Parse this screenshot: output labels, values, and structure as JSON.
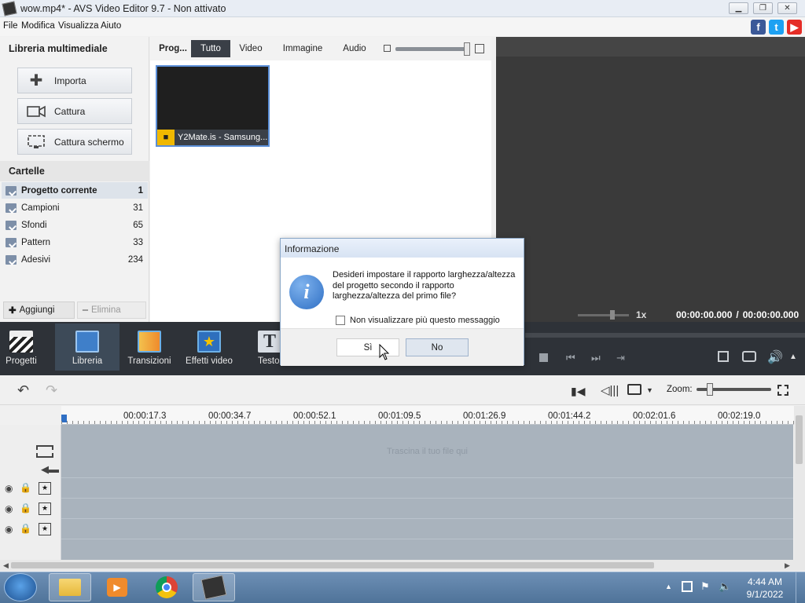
{
  "window": {
    "title": "wow.mp4* - AVS Video Editor 9.7 - Non attivato"
  },
  "menu": [
    "File",
    "Modifica",
    "Visualizza",
    "Aiuto"
  ],
  "social": [
    {
      "name": "facebook",
      "glyph": "f",
      "color": "#3b5998"
    },
    {
      "name": "twitter",
      "glyph": "t",
      "color": "#1da1f2"
    },
    {
      "name": "youtube",
      "glyph": "▶",
      "color": "#e52d27"
    }
  ],
  "library": {
    "title": "Libreria multimediale",
    "buttons": [
      {
        "label": "Importa",
        "icon": "plus-icon"
      },
      {
        "label": "Cattura",
        "icon": "camera-icon"
      },
      {
        "label": "Cattura schermo",
        "icon": "screen-capture-icon"
      }
    ]
  },
  "folders": {
    "title": "Cartelle",
    "items": [
      {
        "label": "Progetto corrente",
        "count": "1",
        "selected": true
      },
      {
        "label": "Campioni",
        "count": "31"
      },
      {
        "label": "Sfondi",
        "count": "65"
      },
      {
        "label": "Pattern",
        "count": "33"
      },
      {
        "label": "Adesivi",
        "count": "234"
      }
    ],
    "add_label": "Aggiungi",
    "delete_label": "Elimina"
  },
  "media": {
    "tabs": [
      {
        "label": "Prog...",
        "bold": true
      },
      {
        "label": "Tutto",
        "active": true
      },
      {
        "label": "Video"
      },
      {
        "label": "Immagine"
      },
      {
        "label": "Audio"
      }
    ],
    "thumbnail_caption": "Y2Mate.is - Samsung..."
  },
  "preview": {
    "speed": "1x",
    "time_current": "00:00:00.000",
    "time_separator": "/",
    "time_total": "00:00:00.000"
  },
  "tools": [
    {
      "label": "Progetti",
      "icon": "clapper-icon"
    },
    {
      "label": "Libreria",
      "icon": "library-icon",
      "active": true
    },
    {
      "label": "Transizioni",
      "icon": "transitions-icon"
    },
    {
      "label": "Effetti video",
      "icon": "video-effects-icon"
    },
    {
      "label": "Testo",
      "icon": "text-icon"
    }
  ],
  "timeline": {
    "zoom_label": "Zoom:",
    "ticks": [
      "00:00:17.3",
      "00:00:34.7",
      "00:00:52.1",
      "00:01:09.5",
      "00:01:26.9",
      "00:01:44.2",
      "00:02:01.6",
      "00:02:19.0"
    ],
    "drop_hint": "Trascina il tuo file qui"
  },
  "dialog": {
    "title": "Informazione",
    "message": "Desideri impostare il rapporto larghezza/altezza del progetto secondo il rapporto larghezza/altezza del primo file?",
    "checkbox_label": "Non visualizzare più questo messaggio",
    "yes_label": "Sì",
    "no_label": "No"
  },
  "taskbar": {
    "time": "4:44 AM",
    "date": "9/1/2022"
  }
}
